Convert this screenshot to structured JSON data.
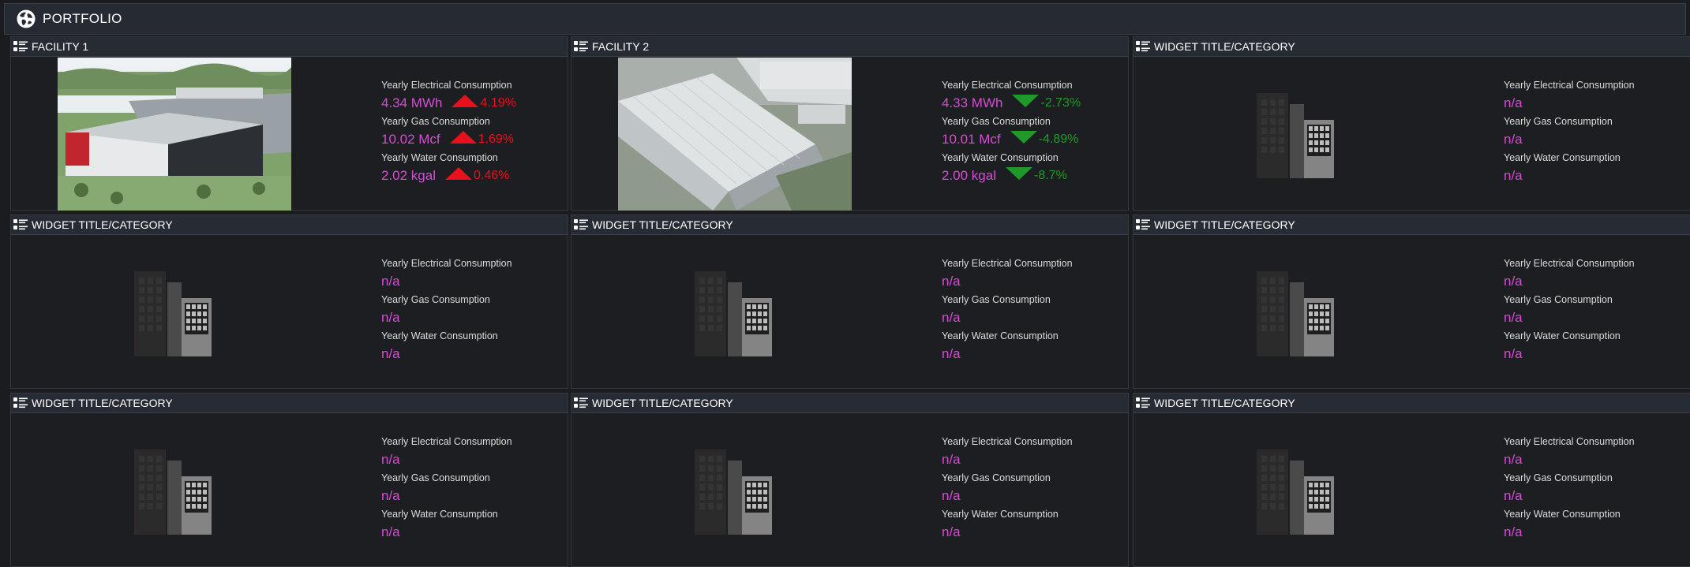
{
  "header": {
    "title": "PORTFOLIO",
    "icon": "globe-icon"
  },
  "colors": {
    "value": "#d24fd0",
    "increase": "#e8101a",
    "decrease": "#1f9a2a",
    "header_bg": "#272b34"
  },
  "widgets": [
    {
      "title": "FACILITY 1",
      "image": "facility-photo",
      "metrics": [
        {
          "label": "Yearly Electrical Consumption",
          "value": "4.34 MWh",
          "trend": "up",
          "change": "4.19%"
        },
        {
          "label": "Yearly Gas Consumption",
          "value": "10.02 Mcf",
          "trend": "up",
          "change": "1.69%"
        },
        {
          "label": "Yearly Water Consumption",
          "value": "2.02 kgal",
          "trend": "up",
          "change": "0.46%"
        }
      ]
    },
    {
      "title": "FACILITY 2",
      "image": "facility-photo",
      "metrics": [
        {
          "label": "Yearly Electrical Consumption",
          "value": "4.33 MWh",
          "trend": "down",
          "change": "-2.73%"
        },
        {
          "label": "Yearly Gas Consumption",
          "value": "10.01 Mcf",
          "trend": "down",
          "change": "-4.89%"
        },
        {
          "label": "Yearly Water Consumption",
          "value": "2.00 kgal",
          "trend": "down",
          "change": "-8.7%"
        }
      ]
    },
    {
      "title": "WIDGET TITLE/CATEGORY",
      "image": "building-icon",
      "metrics": [
        {
          "label": "Yearly Electrical Consumption",
          "value": "n/a"
        },
        {
          "label": "Yearly Gas Consumption",
          "value": "n/a"
        },
        {
          "label": "Yearly Water Consumption",
          "value": "n/a"
        }
      ]
    },
    {
      "title": "WIDGET TITLE/CATEGORY",
      "image": "building-icon",
      "metrics": [
        {
          "label": "Yearly Electrical Consumption",
          "value": "n/a"
        },
        {
          "label": "Yearly Gas Consumption",
          "value": "n/a"
        },
        {
          "label": "Yearly Water Consumption",
          "value": "n/a"
        }
      ]
    },
    {
      "title": "WIDGET TITLE/CATEGORY",
      "image": "building-icon",
      "metrics": [
        {
          "label": "Yearly Electrical Consumption",
          "value": "n/a"
        },
        {
          "label": "Yearly Gas Consumption",
          "value": "n/a"
        },
        {
          "label": "Yearly Water Consumption",
          "value": "n/a"
        }
      ]
    },
    {
      "title": "WIDGET TITLE/CATEGORY",
      "image": "building-icon",
      "metrics": [
        {
          "label": "Yearly Electrical Consumption",
          "value": "n/a"
        },
        {
          "label": "Yearly Gas Consumption",
          "value": "n/a"
        },
        {
          "label": "Yearly Water Consumption",
          "value": "n/a"
        }
      ]
    },
    {
      "title": "WIDGET TITLE/CATEGORY",
      "image": "building-icon",
      "metrics": [
        {
          "label": "Yearly Electrical Consumption",
          "value": "n/a"
        },
        {
          "label": "Yearly Gas Consumption",
          "value": "n/a"
        },
        {
          "label": "Yearly Water Consumption",
          "value": "n/a"
        }
      ]
    },
    {
      "title": "WIDGET TITLE/CATEGORY",
      "image": "building-icon",
      "metrics": [
        {
          "label": "Yearly Electrical Consumption",
          "value": "n/a"
        },
        {
          "label": "Yearly Gas Consumption",
          "value": "n/a"
        },
        {
          "label": "Yearly Water Consumption",
          "value": "n/a"
        }
      ]
    },
    {
      "title": "WIDGET TITLE/CATEGORY",
      "image": "building-icon",
      "metrics": [
        {
          "label": "Yearly Electrical Consumption",
          "value": "n/a"
        },
        {
          "label": "Yearly Gas Consumption",
          "value": "n/a"
        },
        {
          "label": "Yearly Water Consumption",
          "value": "n/a"
        }
      ]
    }
  ]
}
